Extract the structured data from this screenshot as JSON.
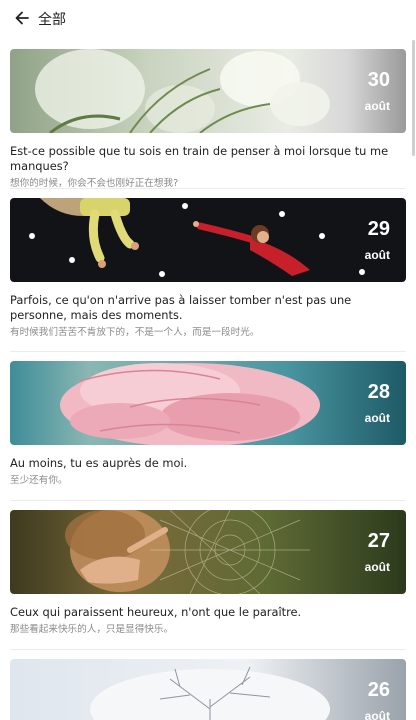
{
  "header": {
    "title": "全部",
    "back_icon": "arrow-left-icon"
  },
  "cards": [
    {
      "day": "30",
      "month": "août",
      "fr": "Est-ce possible que tu sois en train de penser à moi lorsque tu me manques?",
      "zh": "想你的时候，你会不会也刚好正在想我?"
    },
    {
      "day": "29",
      "month": "août",
      "fr": "Parfois, ce qu'on n'arrive pas à laisser tomber n'est pas une personne, mais des moments.",
      "zh": "有时候我们苦苦不肯放下的，不是一个人，而是一段时光。"
    },
    {
      "day": "28",
      "month": "août",
      "fr": "Au moins, tu es auprès de moi.",
      "zh": "至少还有你。"
    },
    {
      "day": "27",
      "month": "août",
      "fr": "Ceux qui paraissent heureux, n'ont que le paraître.",
      "zh": "那些看起来快乐的人，只是显得快乐。"
    },
    {
      "day": "26",
      "month": "août",
      "fr": "",
      "zh": ""
    }
  ]
}
